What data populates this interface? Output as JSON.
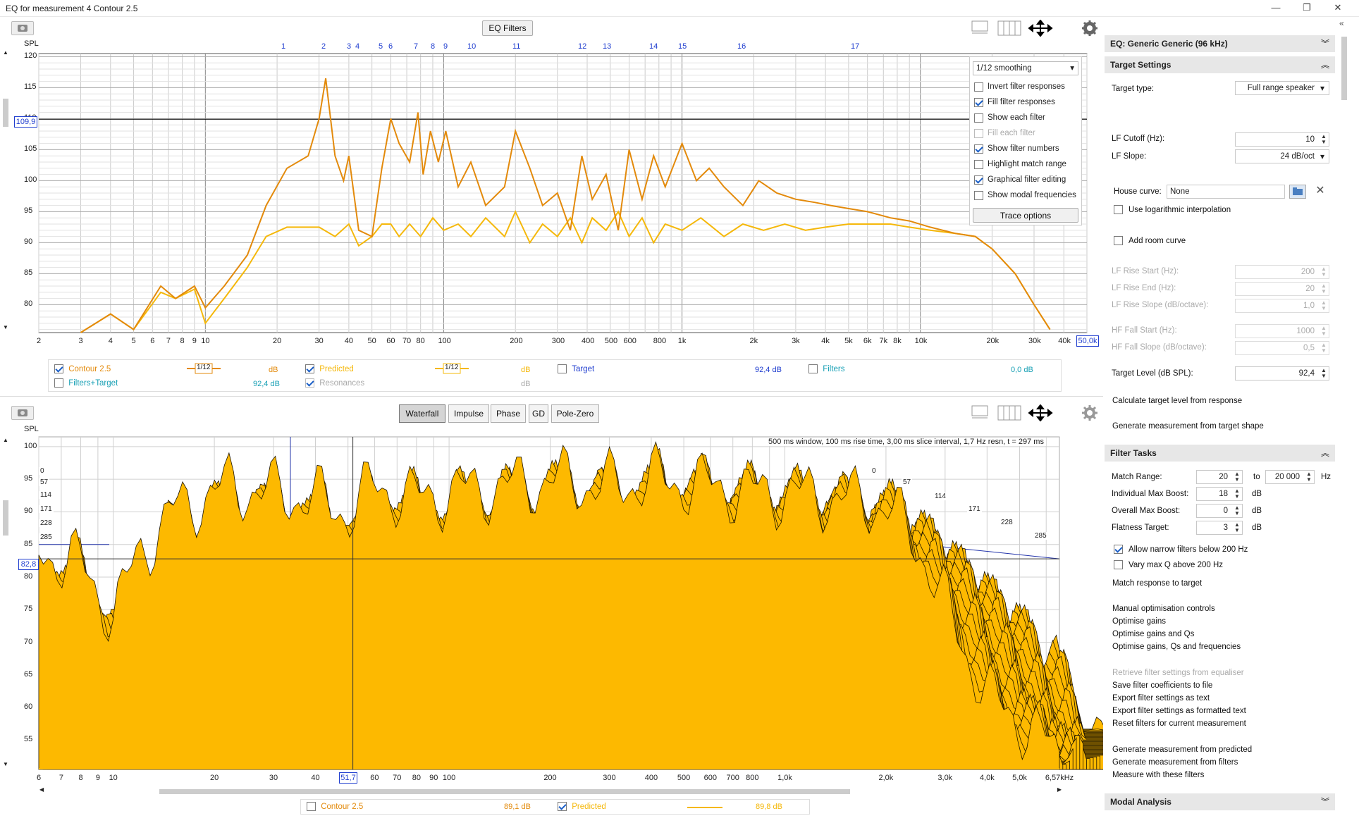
{
  "window": {
    "title": "EQ for measurement 4 Contour 2.5",
    "minimize": "—",
    "maximize": "❐",
    "close": "✕"
  },
  "top_chart": {
    "eq_filters_button": "EQ Filters",
    "y_axis_label": "SPL",
    "y_ticks": [
      "120",
      "115",
      "110",
      "105",
      "100",
      "95",
      "90",
      "85",
      "80"
    ],
    "cursor_y_readout": "109,9",
    "cursor_x_readout": "50,0k",
    "x_ticks": [
      "2",
      "3",
      "4",
      "5",
      "6",
      "7",
      "8",
      "9",
      "10",
      "20",
      "30",
      "40",
      "50",
      "60",
      "70",
      "80",
      "100",
      "200",
      "300",
      "400",
      "500",
      "600",
      "800",
      "1k",
      "2k",
      "3k",
      "4k",
      "5k",
      "6k",
      "7k",
      "8k",
      "10k",
      "20k",
      "30k",
      "40k"
    ],
    "filter_numbers": [
      "1",
      "2",
      "3",
      "4",
      "5",
      "6",
      "7",
      "8",
      "9",
      "10",
      "11",
      "12",
      "13",
      "14",
      "15",
      "16",
      "17"
    ],
    "trace_options": {
      "smoothing": "1/12 smoothing",
      "options": [
        {
          "label": "Invert filter responses",
          "checked": false,
          "disabled": false
        },
        {
          "label": "Fill filter responses",
          "checked": true,
          "disabled": false
        },
        {
          "label": "Show each filter",
          "checked": false,
          "disabled": false
        },
        {
          "label": "Fill each filter",
          "checked": false,
          "disabled": true
        },
        {
          "label": "Show filter numbers",
          "checked": true,
          "disabled": false
        },
        {
          "label": "Highlight match range",
          "checked": false,
          "disabled": false
        },
        {
          "label": "Graphical filter editing",
          "checked": true,
          "disabled": false
        },
        {
          "label": "Show modal frequencies",
          "checked": false,
          "disabled": false
        }
      ],
      "button": "Trace options"
    },
    "legend": {
      "contour": {
        "label": "Contour 2.5",
        "smoothing": "1/12",
        "unit": "dB",
        "checked": true
      },
      "predicted": {
        "label": "Predicted",
        "smoothing": "1/12",
        "unit": "dB",
        "checked": true
      },
      "target": {
        "label": "Target",
        "value": "92,4 dB",
        "checked": false
      },
      "filters": {
        "label": "Filters",
        "value": "0,0 dB",
        "checked": false
      },
      "filters_target": {
        "label": "Filters+Target",
        "value": "92,4 dB",
        "checked": false
      },
      "resonances": {
        "label": "Resonances",
        "unit": "dB",
        "checked": true
      }
    },
    "colors": {
      "measurement": "#e38a0b",
      "predicted": "#f5b80a",
      "filter_numbers": "#1f3dcf"
    }
  },
  "bottom_chart": {
    "tabs": [
      "Waterfall",
      "Impulse",
      "Phase",
      "GD",
      "Pole-Zero"
    ],
    "selected_tab": "Waterfall",
    "y_axis_label": "SPL",
    "y_ticks": [
      "100",
      "95",
      "90",
      "85",
      "80",
      "75",
      "70",
      "65",
      "60",
      "55"
    ],
    "cursor_y_readout": "82,8",
    "cursor_x_readout": "51,7",
    "x_ticks": [
      "6",
      "7",
      "8",
      "9",
      "10",
      "20",
      "30",
      "40",
      "60",
      "70",
      "80",
      "90",
      "100",
      "200",
      "300",
      "400",
      "500",
      "600",
      "700",
      "800",
      "1,0k",
      "2,0k",
      "3,0k",
      "4,0k",
      "5,0k",
      "6,57kHz"
    ],
    "info": "500 ms window, 100 ms rise time, 3,00 ms slice interval, 1,7 Hz resn, t = 297 ms",
    "time_labels": [
      "0",
      "57",
      "114",
      "171",
      "228",
      "285"
    ],
    "legend": {
      "contour": {
        "label": "Contour 2.5",
        "value": "89,1 dB",
        "checked": false
      },
      "predicted": {
        "label": "Predicted",
        "value": "89,8 dB",
        "checked": true
      }
    },
    "colors": {
      "fill": "#fdb900",
      "lines": "#1a1200"
    }
  },
  "side_panel": {
    "eq_header": "EQ: Generic Generic (96 kHz)",
    "target_settings": {
      "header": "Target Settings",
      "target_type_label": "Target type:",
      "target_type_value": "Full range speaker",
      "lf_cutoff_label": "LF Cutoff (Hz):",
      "lf_cutoff_value": "10",
      "lf_slope_label": "LF Slope:",
      "lf_slope_value": "24 dB/oct",
      "house_curve_label": "House curve:",
      "house_curve_value": "None",
      "log_interp_label": "Use logarithmic interpolation",
      "add_room_curve_label": "Add room curve",
      "lf_rise_start_label": "LF Rise Start (Hz):",
      "lf_rise_start_value": "200",
      "lf_rise_end_label": "LF Rise End (Hz):",
      "lf_rise_end_value": "20",
      "lf_rise_slope_label": "LF Rise Slope (dB/octave):",
      "lf_rise_slope_value": "1,0",
      "hf_fall_start_label": "HF Fall Start (Hz):",
      "hf_fall_start_value": "1000",
      "hf_fall_slope_label": "HF Fall Slope (dB/octave):",
      "hf_fall_slope_value": "0,5",
      "target_level_label": "Target Level (dB SPL):",
      "target_level_value": "92,4",
      "calc_target_link": "Calculate target level from response",
      "gen_measurement_link": "Generate measurement from target shape"
    },
    "filter_tasks": {
      "header": "Filter Tasks",
      "match_range_label": "Match Range:",
      "match_from": "20",
      "to_label": "to",
      "match_to": "20 000",
      "hz_unit": "Hz",
      "max_boost_label": "Individual Max Boost:",
      "max_boost_value": "18",
      "db1": "dB",
      "overall_boost_label": "Overall Max Boost:",
      "overall_boost_value": "0",
      "db2": "dB",
      "flatness_label": "Flatness Target:",
      "flatness_value": "3",
      "db3": "dB",
      "allow_narrow_label": "Allow narrow filters below 200 Hz",
      "vary_q_label": "Vary max Q above 200 Hz",
      "match_response": "Match response to target",
      "manual_opt": "Manual optimisation controls",
      "opt_gains": "Optimise gains",
      "opt_gains_qs": "Optimise gains and Qs",
      "opt_gains_qs_freq": "Optimise gains, Qs and frequencies",
      "retrieve": "Retrieve filter settings from equaliser",
      "save_coeffs": "Save filter coefficients to file",
      "export_text": "Export filter settings as text",
      "export_formatted": "Export filter settings as formatted text",
      "reset_filters": "Reset filters for current measurement",
      "gen_predicted": "Generate measurement from predicted",
      "gen_filters": "Generate measurement from filters",
      "measure_with": "Measure with these filters"
    },
    "modal_analysis_header": "Modal Analysis"
  }
}
